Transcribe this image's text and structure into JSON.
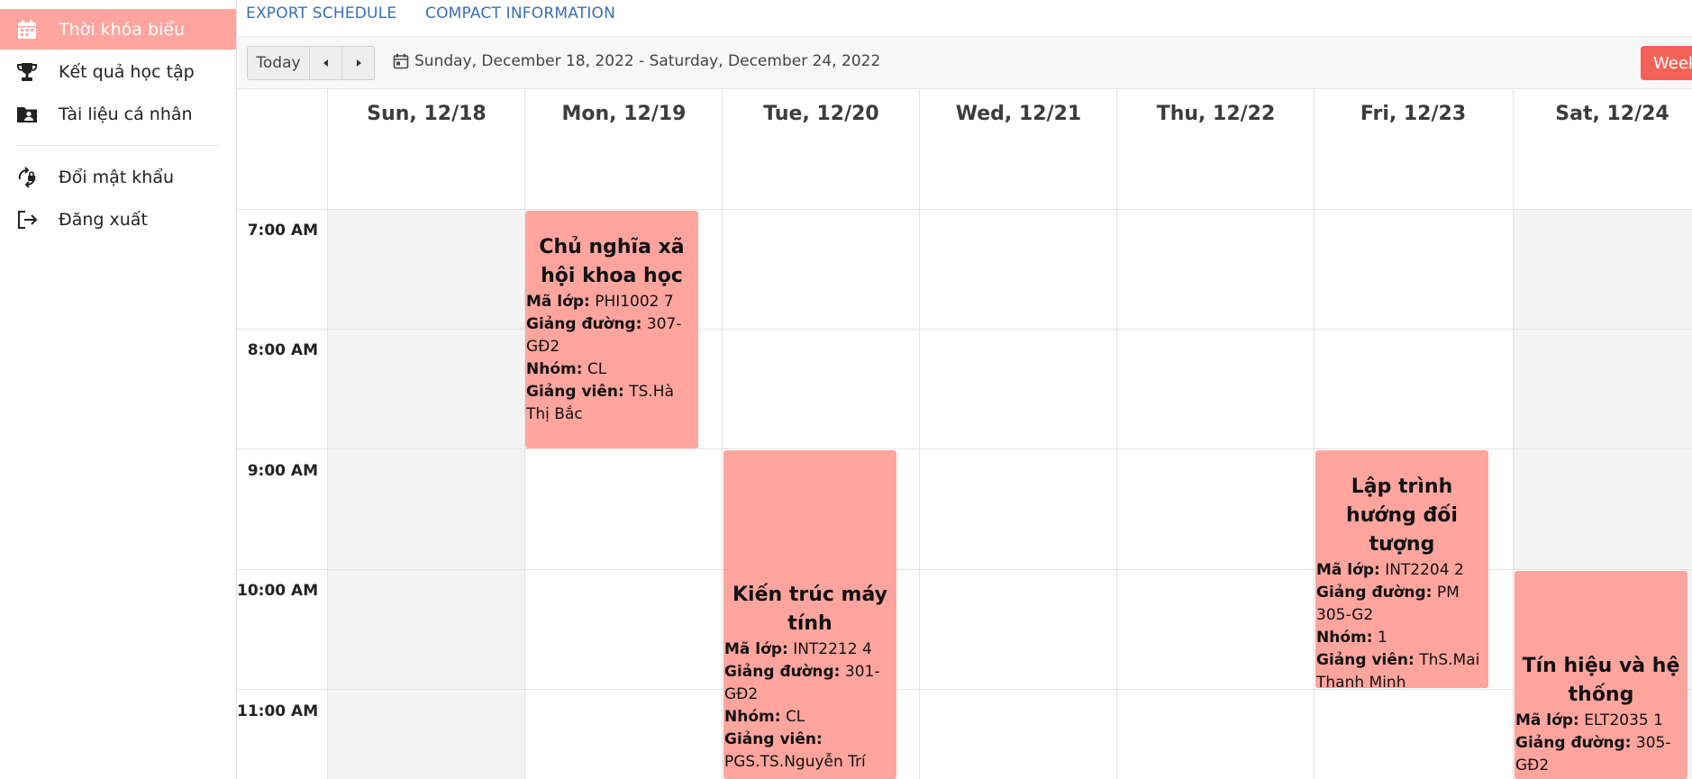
{
  "sidebar": {
    "items": [
      {
        "label": "Thời khóa biểu",
        "icon": "calendar-icon",
        "active": true
      },
      {
        "label": "Kết quả học tập",
        "icon": "trophy-icon",
        "active": false
      },
      {
        "label": "Tài liệu cá nhân",
        "icon": "folder-user-icon",
        "active": false
      },
      {
        "label": "Đổi mật khẩu",
        "icon": "password-change-icon",
        "active": false
      },
      {
        "label": "Đăng xuất",
        "icon": "logout-icon",
        "active": false
      }
    ]
  },
  "top_links": {
    "export": "EXPORT SCHEDULE",
    "compact": "COMPACT INFORMATION"
  },
  "toolbar": {
    "today_label": "Today",
    "prev_icon": "caret-left-icon",
    "next_icon": "caret-right-icon",
    "date_range": "Sunday, December 18, 2022 - Saturday, December 24, 2022",
    "view_label": "Week"
  },
  "calendar": {
    "days": [
      "Sun, 12/18",
      "Mon, 12/19",
      "Tue, 12/20",
      "Wed, 12/21",
      "Thu, 12/22",
      "Fri, 12/23",
      "Sat, 12/24"
    ],
    "times": [
      "7:00 AM",
      "8:00 AM",
      "9:00 AM",
      "10:00 AM",
      "11:00 AM"
    ],
    "events": [
      {
        "title": "Chủ nghĩa xã hội khoa học",
        "ma_lop_label": "Mã lớp:",
        "ma_lop": "PHI1002 7",
        "giang_duong_label": "Giảng đường:",
        "giang_duong": "307-GĐ2",
        "nhom_label": "Nhóm:",
        "nhom": "CL",
        "giang_vien_label": "Giảng viên:",
        "giang_vien": "TS.Hà Thị Bắc"
      },
      {
        "title": "Kiến trúc máy tính",
        "ma_lop_label": "Mã lớp:",
        "ma_lop": "INT2212 4",
        "giang_duong_label": "Giảng đường:",
        "giang_duong": "301-GĐ2",
        "nhom_label": "Nhóm:",
        "nhom": "CL",
        "giang_vien_label": "Giảng viên:",
        "giang_vien": "PGS.TS.Nguyễn Trí"
      },
      {
        "title": "Lập trình hướng đối tượng",
        "ma_lop_label": "Mã lớp:",
        "ma_lop": "INT2204 2",
        "giang_duong_label": "Giảng đường:",
        "giang_duong": "PM 305-G2",
        "nhom_label": "Nhóm:",
        "nhom": "1",
        "giang_vien_label": "Giảng viên:",
        "giang_vien": "ThS.Mai Thanh Minh"
      },
      {
        "title": "Tín hiệu và hệ thống",
        "ma_lop_label": "Mã lớp:",
        "ma_lop": "ELT2035 1",
        "giang_duong_label": "Giảng đường:",
        "giang_duong": "305-GĐ2"
      }
    ]
  },
  "colors": {
    "accent": "#ffa59e",
    "active_button": "#f56258",
    "link": "#3a6db5"
  }
}
